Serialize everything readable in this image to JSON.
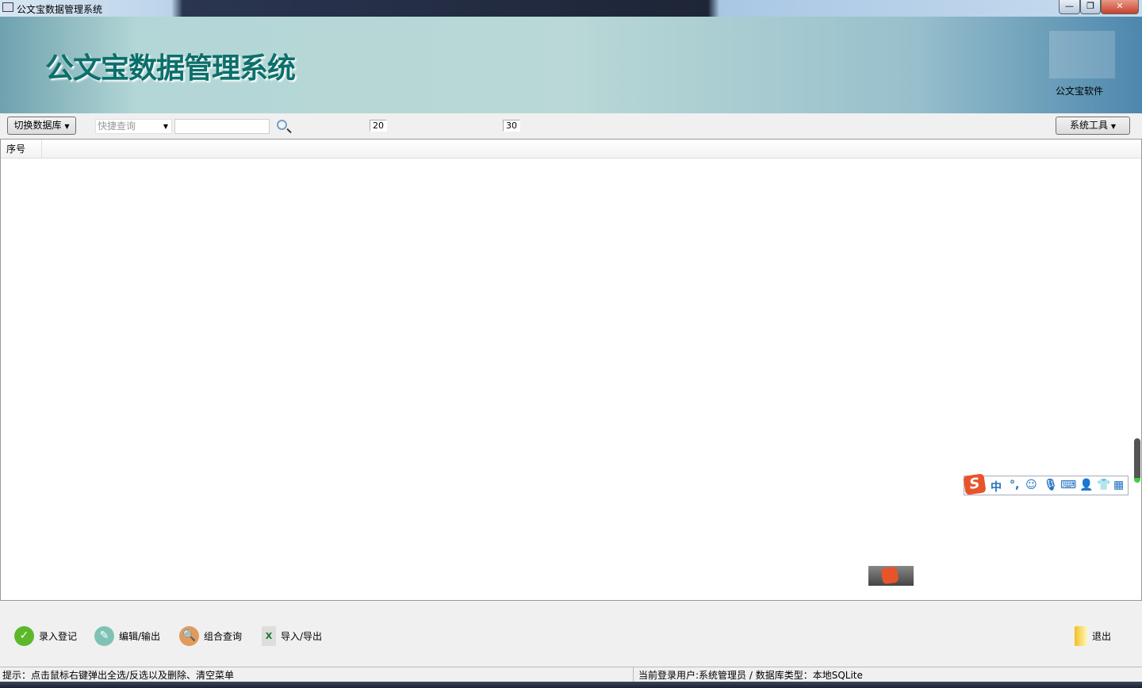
{
  "window": {
    "title": "公文宝数据管理系统",
    "minimize": "—",
    "restore": "❐",
    "close": "✕"
  },
  "banner": {
    "title": "公文宝数据管理系统",
    "company": "公文宝软件"
  },
  "toolbar": {
    "switch_db": "切换数据库",
    "quick_query_placeholder": "快捷查询",
    "search_value": "",
    "field1": "20",
    "field2": "30",
    "system_tools": "系统工具"
  },
  "grid": {
    "columns": [
      "序号"
    ]
  },
  "ime": {
    "logo": "S",
    "mode": "中",
    "punct": "°,"
  },
  "actions": {
    "register": "录入登记",
    "edit": "编辑/输出",
    "combo_query": "组合查询",
    "import_export": "导入/导出",
    "exit": "退出"
  },
  "status": {
    "hint": "提示：点击鼠标右键弹出全选/反选以及删除、清空菜单",
    "user_info": "当前登录用户:系统管理员 / 数据库类型：本地SQLite"
  }
}
